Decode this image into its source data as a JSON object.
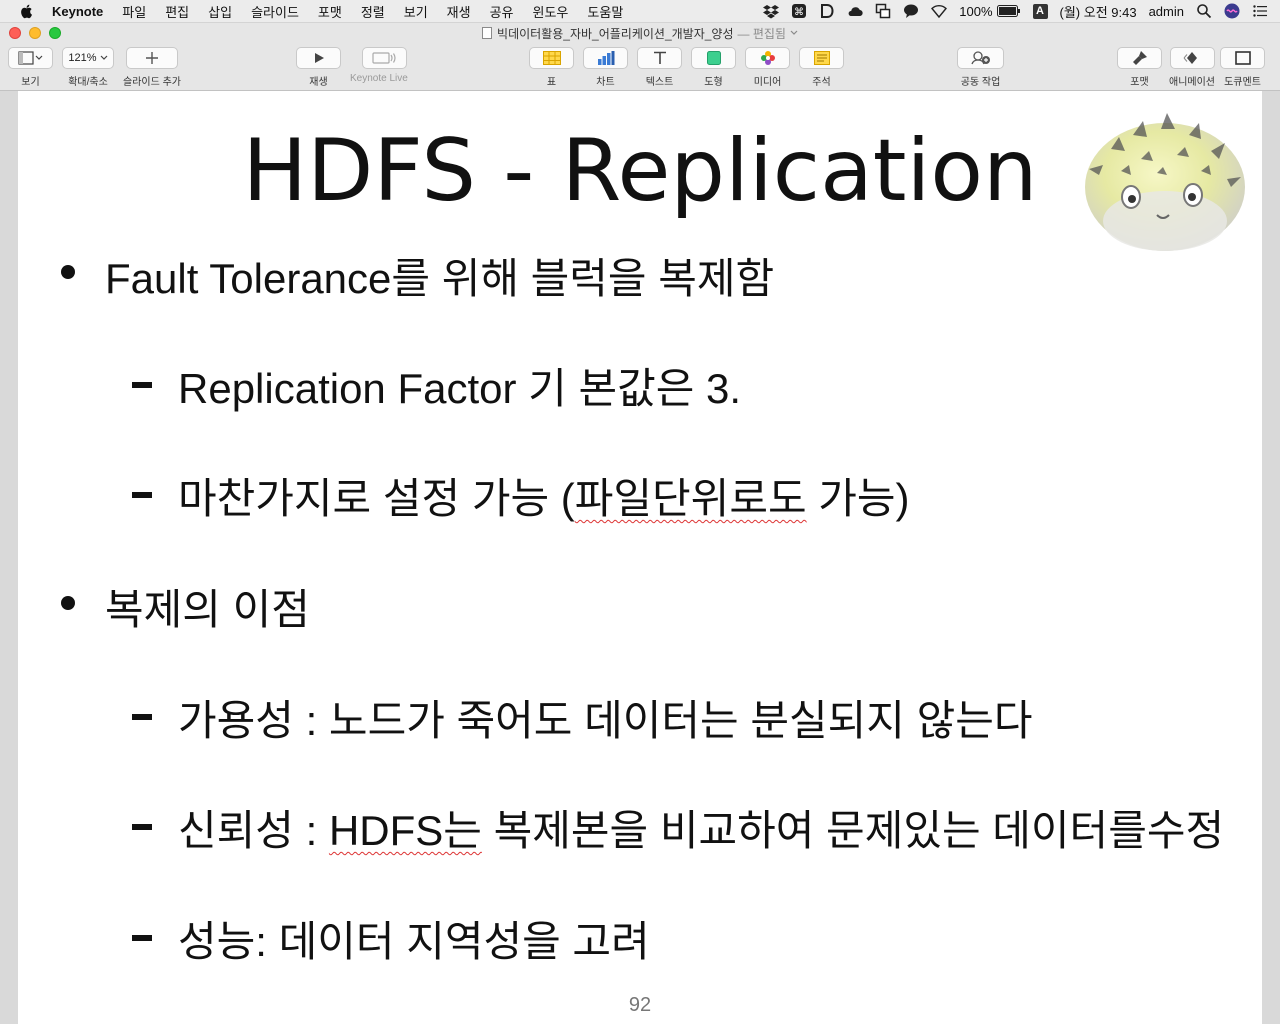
{
  "menubar": {
    "app": "Keynote",
    "items": [
      "파일",
      "편집",
      "삽입",
      "슬라이드",
      "포맷",
      "정렬",
      "보기",
      "재생",
      "공유",
      "윈도우",
      "도움말"
    ],
    "battery": "100%",
    "input_source": "A",
    "datetime": "(월) 오전 9:43",
    "user": "admin"
  },
  "window": {
    "title": "빅데이터활용_자바_어플리케이션_개발자_양성",
    "title_status": "— 편집됨"
  },
  "toolbar": {
    "view": "보기",
    "zoom_value": "121%",
    "zoom_label": "확대/축소",
    "add_slide": "슬라이드 추가",
    "play": "재생",
    "keynote_live": "Keynote Live",
    "table": "표",
    "chart": "차트",
    "text": "텍스트",
    "shape": "도형",
    "media": "미디어",
    "comment": "주석",
    "collaborate": "공동 작업",
    "format": "포맷",
    "animate": "애니메이션",
    "document": "도큐멘트"
  },
  "slide": {
    "title": "HDFS - Replication",
    "b1": "Fault Tolerance를 위해 블럭을 복제함",
    "b1s1": "Replication Factor 기 본값은 3.",
    "b1s2_a": "마찬가지로 설정 가능 (",
    "b1s2_b": "파일단위로도",
    "b1s2_c": " 가능)",
    "b2": "복제의 이점",
    "b2s1": "가용성 : 노드가 죽어도 데이터는 분실되지 않는다",
    "b2s2_a": "신뢰성 : ",
    "b2s2_b": "HDFS는",
    "b2s2_c": " 복제본을 비교하여 문제있는 데이터를수정",
    "b2s3": "성능: 데이터 지역성을 고려",
    "page_number": "92"
  }
}
